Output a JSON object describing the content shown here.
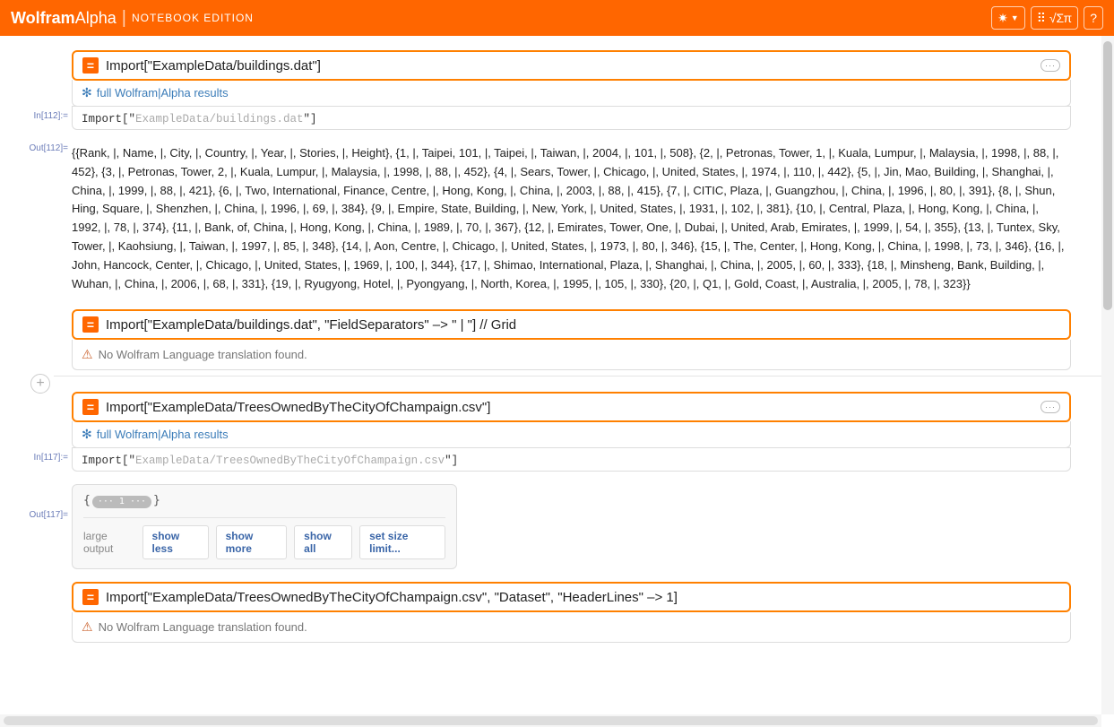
{
  "header": {
    "logo_bold": "Wolfram",
    "logo_rest": "Alpha",
    "subtitle": "Notebook Edition",
    "gear_glyph": "✷",
    "keyboard_glyph": "⠿ √Σπ",
    "help_glyph": "?"
  },
  "labels": {
    "full_results": "full Wolfram|Alpha results",
    "no_translation": "No Wolfram Language translation found.",
    "large_output": "large output",
    "show_less": "show less",
    "show_more": "show more",
    "show_all": "show all",
    "set_size": "set size limit...",
    "add": "+",
    "ellipsis": "···",
    "pill_left": "···",
    "pill_num": "1",
    "pill_right": "···"
  },
  "cells": {
    "c1": {
      "in_label": "In[112]:=",
      "out_label": "Out[112]=",
      "input": "Import[\"ExampleData/buildings.dat\"]",
      "code_prefix": "Import[\"",
      "code_gray": "ExampleData/buildings.dat",
      "code_suffix": "\"]",
      "output": "{{Rank, |, Name, |, City, |, Country, |, Year, |, Stories, |, Height}, {1, |, Taipei, 101, |, Taipei, |, Taiwan, |, 2004, |, 101, |, 508}, {2, |, Petronas, Tower, 1, |, Kuala, Lumpur, |, Malaysia, |, 1998, |, 88, |, 452}, {3, |, Petronas, Tower, 2, |, Kuala, Lumpur, |, Malaysia, |, 1998, |, 88, |, 452}, {4, |, Sears, Tower, |, Chicago, |, United, States, |, 1974, |, 110, |, 442}, {5, |, Jin, Mao, Building, |, Shanghai, |, China, |, 1999, |, 88, |, 421}, {6, |, Two, International, Finance, Centre, |, Hong, Kong, |, China, |, 2003, |, 88, |, 415}, {7, |, CITIC, Plaza, |, Guangzhou, |, China, |, 1996, |, 80, |, 391}, {8, |, Shun, Hing, Square, |, Shenzhen, |, China, |, 1996, |, 69, |, 384}, {9, |, Empire, State, Building, |, New, York, |, United, States, |, 1931, |, 102, |, 381}, {10, |, Central, Plaza, |, Hong, Kong, |, China, |, 1992, |, 78, |, 374}, {11, |, Bank, of, China, |, Hong, Kong, |, China, |, 1989, |, 70, |, 367}, {12, |, Emirates, Tower, One, |, Dubai, |, United, Arab, Emirates, |, 1999, |, 54, |, 355}, {13, |, Tuntex, Sky, Tower, |, Kaohsiung, |, Taiwan, |, 1997, |, 85, |, 348}, {14, |, Aon, Centre, |, Chicago, |, United, States, |, 1973, |, 80, |, 346}, {15, |, The, Center, |, Hong, Kong, |, China, |, 1998, |, 73, |, 346}, {16, |, John, Hancock, Center, |, Chicago, |, United, States, |, 1969, |, 100, |, 344}, {17, |, Shimao, International, Plaza, |, Shanghai, |, China, |, 2005, |, 60, |, 333}, {18, |, Minsheng, Bank, Building, |, Wuhan, |, China, |, 2006, |, 68, |, 331}, {19, |, Ryugyong, Hotel, |, Pyongyang, |, North, Korea, |, 1995, |, 105, |, 330}, {20, |, Q1, |, Gold, Coast, |, Australia, |, 2005, |, 78, |, 323}}"
    },
    "c2": {
      "input": "Import[\"ExampleData/buildings.dat\", \"FieldSeparators\" –> \" | \"] // Grid"
    },
    "c3": {
      "in_label": "In[117]:=",
      "out_label": "Out[117]=",
      "input": "Import[\"ExampleData/TreesOwnedByTheCityOfChampaign.csv\"]",
      "code_prefix": "Import[\"",
      "code_gray": "ExampleData/TreesOwnedByTheCityOfChampaign.csv",
      "code_suffix": "\"]"
    },
    "c4": {
      "input": "Import[\"ExampleData/TreesOwnedByTheCityOfChampaign.csv\", \"Dataset\", \"HeaderLines\" –> 1]"
    }
  }
}
